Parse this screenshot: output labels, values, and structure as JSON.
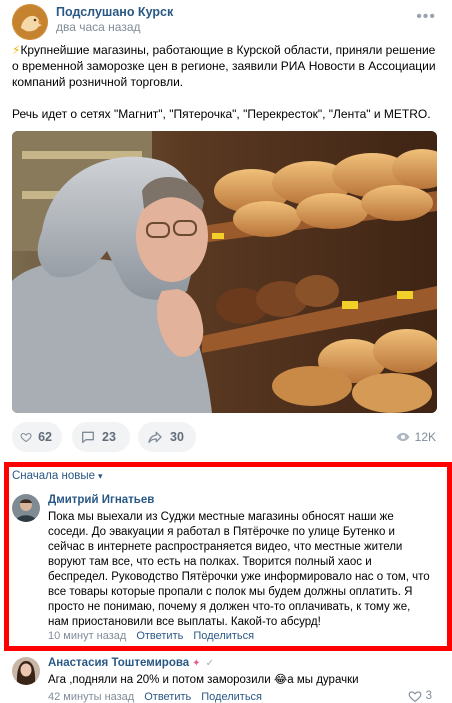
{
  "post": {
    "group_name": "Подслушано Курск",
    "time": "два часа назад",
    "more_label": "•••",
    "paragraph1": "Крупнейшие магазины, работающие в Курской области, приняли решение о временной заморозке цен в регионе, заявили РИА Новости в Ассоциации компаний розничной торговли.",
    "paragraph2": "Речь идет о сетях \"Магнит\", \"Пятерочка\", \"Перекресток\", \"Лента\" и METRO."
  },
  "actions": {
    "likes": "62",
    "comments": "23",
    "shares": "30",
    "views": "12K"
  },
  "comments_section": {
    "sort_label": "Сначала новые",
    "items": [
      {
        "author": "Дмитрий Игнатьев",
        "text": "Пока мы выехали из Суджи местные магазины обносят наши же соседи. До эвакуации я работал в Пятёрочке по улице Бутенко и сейчас в интернете распространяется видео, что местные жители воруют там все, что есть на полках. Творится полный хаос и беспредел. Руководство Пятёрочки уже информировало нас о том, что все товары которые пропали с полок мы будем должны оплатить. Я просто не понимаю, почему я должен что-то оплачивать, к тому же, нам приостановили все выплаты. Какой-то абсурд!",
        "time": "10 минут назад",
        "reply_label": "Ответить",
        "share_label": "Поделиться"
      },
      {
        "author": "Анастасия Тоштемирова",
        "text": "Ага ,подняли на 20% и потом заморозили 😂а мы дурачки",
        "time": "42 минуты назад",
        "reply_label": "Ответить",
        "share_label": "Поделиться",
        "likes": "3"
      }
    ]
  },
  "colors": {
    "link": "#2a5885",
    "meta": "#818c99",
    "highlight_border": "#ff0000",
    "button_bg": "#f2f3f5"
  }
}
